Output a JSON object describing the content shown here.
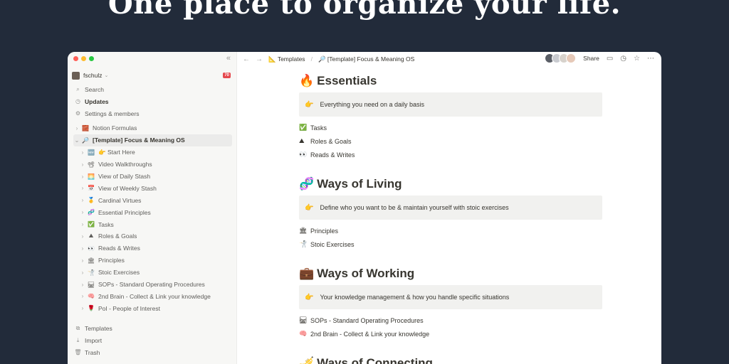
{
  "hero": "One place to organize your life.",
  "sidebar": {
    "workspace": "fschulz",
    "badge": "70",
    "nav": [
      {
        "icon": "search-icon",
        "glyph": "⌕",
        "label": "Search"
      },
      {
        "icon": "clock-icon",
        "glyph": "◷",
        "label": "Updates"
      },
      {
        "icon": "gear-icon",
        "glyph": "⚙",
        "label": "Settings & members"
      }
    ],
    "tree": [
      {
        "emoji": "🧱",
        "label": "Notion Formulas",
        "child": false,
        "active": false
      },
      {
        "emoji": "🔎",
        "label": "[Template] Focus & Meaning OS",
        "child": false,
        "active": true
      },
      {
        "emoji": "🆕",
        "label": "👉 Start Here",
        "child": true,
        "active": false
      },
      {
        "emoji": "📽",
        "label": "Video Walkthroughs",
        "child": true,
        "active": false
      },
      {
        "emoji": "🌅",
        "label": "View of Daily Stash",
        "child": true,
        "active": false
      },
      {
        "emoji": "📅",
        "label": "View of Weekly Stash",
        "child": true,
        "active": false
      },
      {
        "emoji": "🥇",
        "label": "Cardinal Virtues",
        "child": true,
        "active": false
      },
      {
        "emoji": "🧬",
        "label": "Essential Principles",
        "child": true,
        "active": false
      },
      {
        "emoji": "✅",
        "label": "Tasks",
        "child": true,
        "active": false
      },
      {
        "emoji": "⛰",
        "label": "Roles & Goals",
        "child": true,
        "active": false
      },
      {
        "emoji": "👀",
        "label": "Reads & Writes",
        "child": true,
        "active": false
      },
      {
        "emoji": "🏛",
        "label": "Principles",
        "child": true,
        "active": false
      },
      {
        "emoji": "🤺",
        "label": "Stoic Exercises",
        "child": true,
        "active": false
      },
      {
        "emoji": "🛤",
        "label": "SOPs - Standard Operating Procedures",
        "child": true,
        "active": false
      },
      {
        "emoji": "🧠",
        "label": "2nd Brain - Collect & Link your knowledge",
        "child": true,
        "active": false
      },
      {
        "emoji": "🌹",
        "label": "PoI - People of Interest",
        "child": true,
        "active": false
      }
    ],
    "bottom": [
      {
        "icon": "templates-icon",
        "glyph": "⧉",
        "label": "Templates"
      },
      {
        "icon": "import-icon",
        "glyph": "⤓",
        "label": "Import"
      },
      {
        "icon": "trash-icon",
        "glyph": "🗑",
        "label": "Trash"
      }
    ]
  },
  "topbar": {
    "crumb1_emoji": "📐",
    "crumb1": "Templates",
    "crumb2_emoji": "🔎",
    "crumb2": "[Template] Focus & Meaning OS",
    "share": "Share"
  },
  "sections": [
    {
      "emoji": "🔥",
      "title": "Essentials",
      "callout_emoji": "👉",
      "callout": "Everything you need on a daily basis",
      "items": [
        {
          "emoji": "✅",
          "label": "Tasks"
        },
        {
          "emoji": "⛰",
          "label": "Roles & Goals"
        },
        {
          "emoji": "👀",
          "label": "Reads & Writes"
        }
      ]
    },
    {
      "emoji": "🧬",
      "title": "Ways of Living",
      "callout_emoji": "👉",
      "callout": "Define who you want to be & maintain yourself with stoic exercises",
      "items": [
        {
          "emoji": "🏛",
          "label": "Principles"
        },
        {
          "emoji": "🤺",
          "label": "Stoic Exercises"
        }
      ]
    },
    {
      "emoji": "💼",
      "title": "Ways of Working",
      "callout_emoji": "👉",
      "callout": "Your knowledge management & how you handle specific situations",
      "items": [
        {
          "emoji": "🛤",
          "label": "SOPs - Standard Operating Procedures"
        },
        {
          "emoji": "🧠",
          "label": "2nd Brain - Collect & Link your knowledge"
        }
      ]
    },
    {
      "emoji": "🎺",
      "title": "Ways of Connecting",
      "callout_emoji": "",
      "callout": "",
      "items": []
    }
  ]
}
